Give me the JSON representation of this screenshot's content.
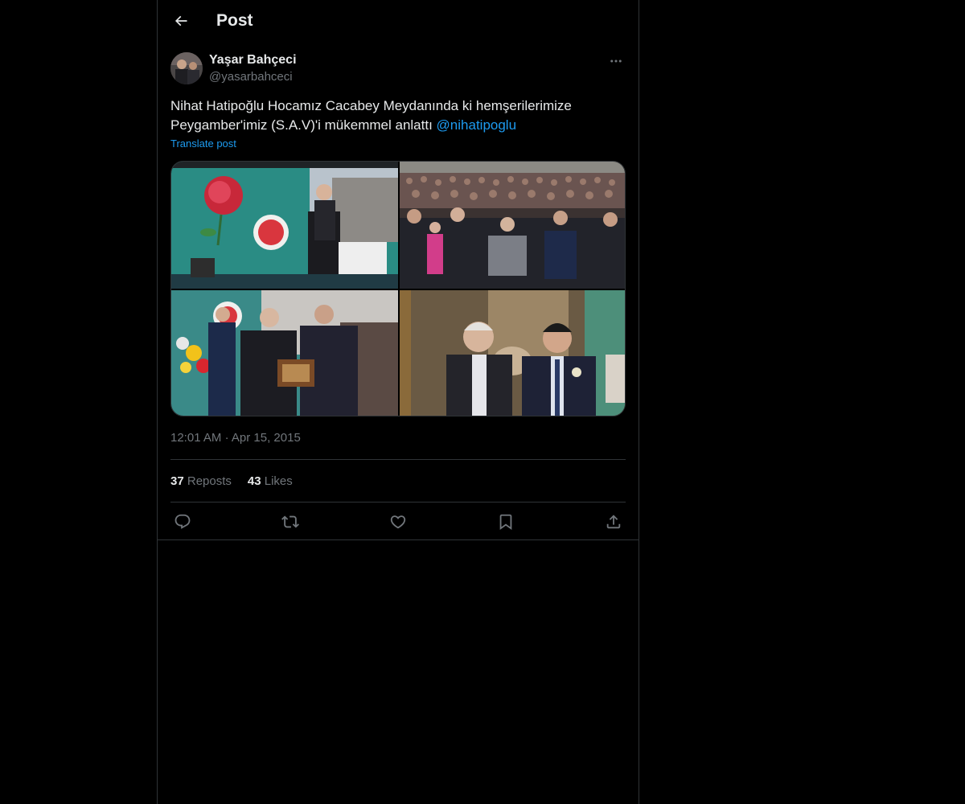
{
  "header": {
    "title": "Post",
    "back_icon": "arrow-left-icon"
  },
  "post": {
    "author": {
      "display_name": "Yaşar Bahçeci",
      "handle": "@yasarbahceci"
    },
    "text": "Nihat Hatipoğlu Hocamız Cacabey Meydanında ki hemşerilerimize Peygamber'imiz (S.A.V)'i mükemmel anlattı",
    "mention": "@nihatipoglu",
    "translate_label": "Translate post",
    "media_count": 4,
    "time": "12:01 AM",
    "separator": "·",
    "date": "Apr 15, 2015",
    "stats": {
      "reposts_count": "37",
      "reposts_label": "Reposts",
      "likes_count": "43",
      "likes_label": "Likes"
    },
    "actions": [
      "reply-icon",
      "repost-icon",
      "like-icon",
      "bookmark-icon",
      "share-icon"
    ]
  },
  "colors": {
    "background": "#000000",
    "text": "#e7e9ea",
    "secondary": "#71767b",
    "accent": "#1d9bf0",
    "border": "#2f3336"
  }
}
